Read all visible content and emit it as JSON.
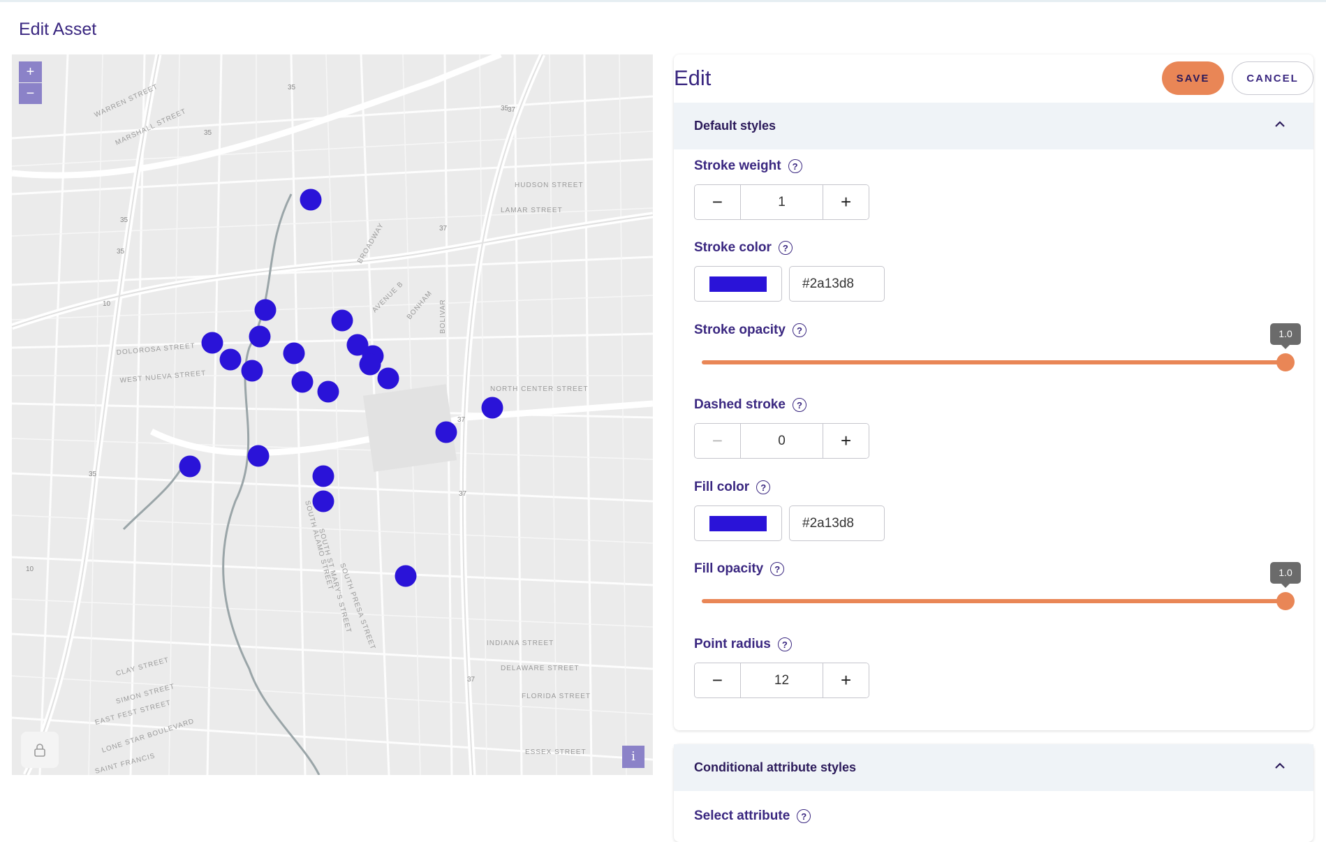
{
  "page": {
    "title": "Edit Asset"
  },
  "editor": {
    "title": "Edit",
    "save_label": "SAVE",
    "cancel_label": "CANCEL"
  },
  "default_styles": {
    "header": "Default styles",
    "stroke_weight": {
      "label": "Stroke weight",
      "value": "1"
    },
    "stroke_color": {
      "label": "Stroke color",
      "value": "#2a13d8"
    },
    "stroke_opacity": {
      "label": "Stroke opacity",
      "value": 1.0,
      "display": "1.0"
    },
    "dashed_stroke": {
      "label": "Dashed stroke",
      "value": "0"
    },
    "fill_color": {
      "label": "Fill color",
      "value": "#2a13d8"
    },
    "fill_opacity": {
      "label": "Fill opacity",
      "value": 1.0,
      "display": "1.0"
    },
    "point_radius": {
      "label": "Point radius",
      "value": "12"
    }
  },
  "conditional": {
    "header": "Conditional attribute styles",
    "select_attribute_label": "Select attribute"
  },
  "map": {
    "zoom_in": "+",
    "zoom_out": "−",
    "info": "i",
    "street_labels": [
      "WARREN STREET",
      "MARSHALL STREET",
      "HUDSON STREET",
      "LAMAR STREET",
      "DOLOROSA STREET",
      "WEST NUEVA STREET",
      "NORTH CENTER STREET",
      "INDIANA STREET",
      "DELAWARE STREET",
      "FLORIDA STREET",
      "ESSEX STREET",
      "SIMON STREET",
      "EAST FEST STREET",
      "LONE STAR BOULEVARD",
      "SAINT FRANCIS",
      "CLAY STREET",
      "BROADWAY",
      "AVENUE B",
      "BONHAM",
      "SOUTH ALAMO STREET",
      "SOUTH ST MARY'S STREET",
      "SOUTH PRESA STREET",
      "BOLIVAR"
    ],
    "points_color": "#2a13d8"
  },
  "colors": {
    "accent": "#e98656",
    "primary_text": "#3a2780",
    "section_bg": "#eff3f7"
  }
}
